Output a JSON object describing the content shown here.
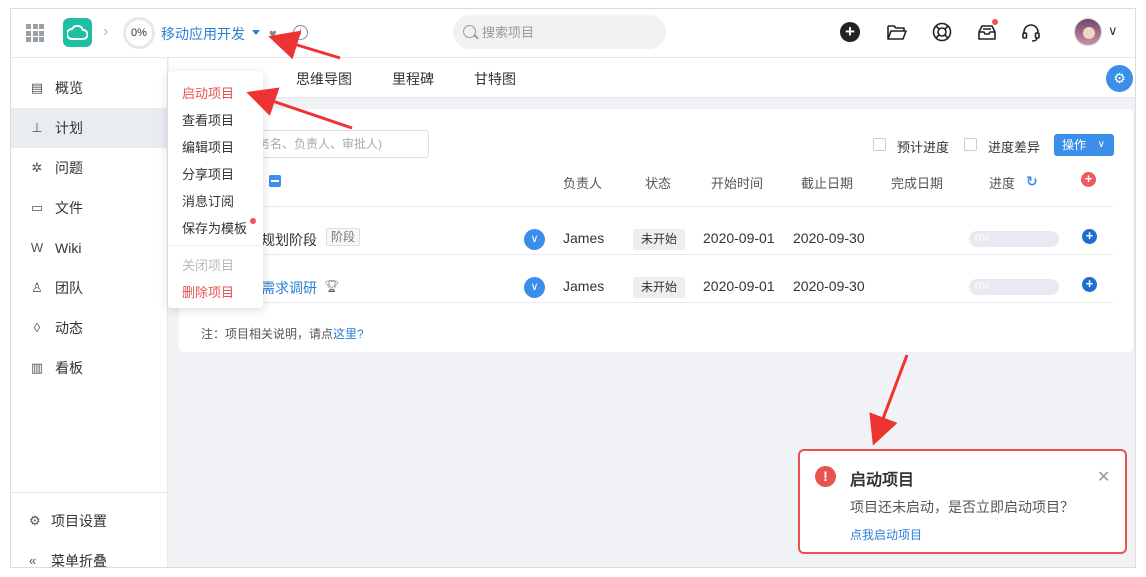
{
  "header": {
    "progress_label": "0%",
    "project_name": "移动应用开发",
    "search_placeholder": "搜索项目"
  },
  "tabs": [
    "思维导图",
    "里程碑",
    "甘特图"
  ],
  "sidebar": {
    "items": [
      {
        "icon": "list-icon",
        "label": "概览"
      },
      {
        "icon": "sitemap-icon",
        "label": "计划"
      },
      {
        "icon": "bug-icon",
        "label": "问题"
      },
      {
        "icon": "folder-icon",
        "label": "文件"
      },
      {
        "icon": "wiki-icon",
        "label": "Wiki"
      },
      {
        "icon": "team-icon",
        "label": "团队"
      },
      {
        "icon": "fire-icon",
        "label": "动态"
      },
      {
        "icon": "chart-icon",
        "label": "看板"
      }
    ],
    "settings_label": "项目设置",
    "collapse_label": "菜单折叠"
  },
  "dropdown": {
    "start": "启动项目",
    "view": "查看项目",
    "edit": "编辑项目",
    "share": "分享项目",
    "subscribe": "消息订阅",
    "save_template": "保存为模板",
    "close": "关闭项目",
    "delete": "删除项目"
  },
  "toolbar": {
    "filter_placeholder": "任务名、负责人、审批人)",
    "expected_progress": "预计进度",
    "progress_diff": "进度差异",
    "operate_button": "操作"
  },
  "table": {
    "headers": {
      "owner": "负责人",
      "status": "状态",
      "start": "开始时间",
      "deadline": "截止日期",
      "finish": "完成日期",
      "progress": "进度"
    },
    "rows": [
      {
        "name": "规划阶段",
        "tag": "阶段",
        "owner": "James",
        "status": "未开始",
        "start": "2020-09-01",
        "deadline": "2020-09-30",
        "progress": "0%"
      },
      {
        "name": "需求调研",
        "owner": "James",
        "status": "未开始",
        "start": "2020-09-01",
        "deadline": "2020-09-30",
        "progress": "0%"
      }
    ]
  },
  "note": {
    "prefix": "注：项目相关说明，请点",
    "link": "这里?"
  },
  "notification": {
    "title": "启动项目",
    "body": "项目还未启动，是否立即启动项目？",
    "link": "点我启动项目"
  },
  "colors": {
    "accent": "#3b8ee9",
    "danger": "#e8534f",
    "logo": "#1fbfa1"
  }
}
